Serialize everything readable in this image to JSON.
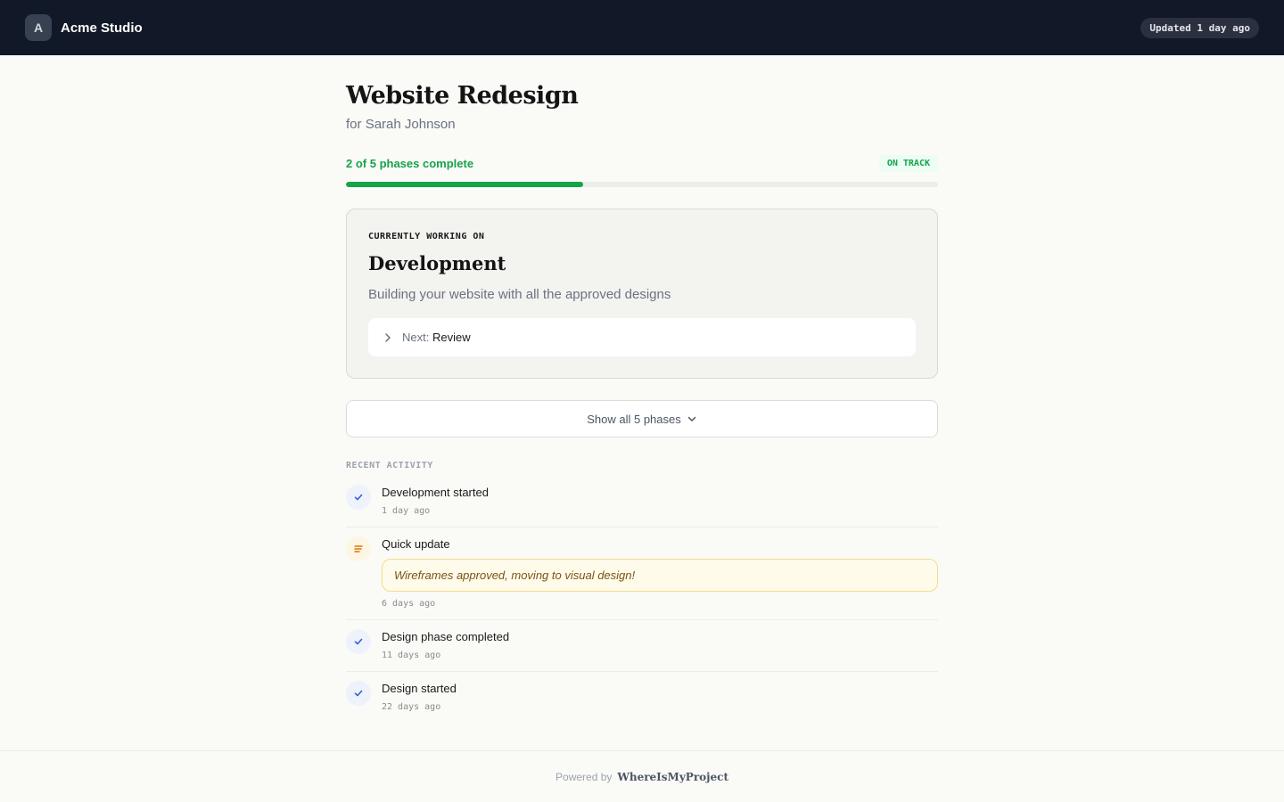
{
  "header": {
    "avatar_initial": "A",
    "studio_name": "Acme Studio",
    "updated_text": "Updated 1 day ago"
  },
  "project": {
    "title": "Website Redesign",
    "client_prefix": "for",
    "client_name": "Sarah Johnson"
  },
  "progress": {
    "label": "2 of 5 phases complete",
    "completed_phases": 2,
    "total_phases": 5,
    "status_badge": "ON TRACK",
    "fill_fraction": 0.4,
    "color": "#16a34a"
  },
  "current_phase": {
    "eyebrow": "CURRENTLY WORKING ON",
    "title": "Development",
    "description": "Building your website with all the approved designs",
    "next_label": "Next:",
    "next_value": "Review",
    "next_icon": "chevron-right-icon"
  },
  "show_all": {
    "label": "Show all 5 phases",
    "icon": "chevron-down-icon"
  },
  "activity": {
    "section_label": "RECENT ACTIVITY",
    "items": [
      {
        "title": "Development started",
        "time": "1 day ago",
        "icon": "check-icon"
      },
      {
        "title": "Quick update",
        "note": "Wireframes approved, moving to visual design!",
        "time": "6 days ago",
        "icon": "note-icon"
      },
      {
        "title": "Design phase completed",
        "time": "11 days ago",
        "icon": "check-icon"
      },
      {
        "title": "Design started",
        "time": "22 days ago",
        "icon": "check-icon"
      }
    ]
  },
  "footer": {
    "powered_label": "Powered by",
    "brand": "WhereIsMyProject"
  },
  "colors": {
    "header_bg": "#111827",
    "accent_green": "#16a34a",
    "note_bg": "#fffbeb",
    "note_border": "#f4dc8b"
  }
}
